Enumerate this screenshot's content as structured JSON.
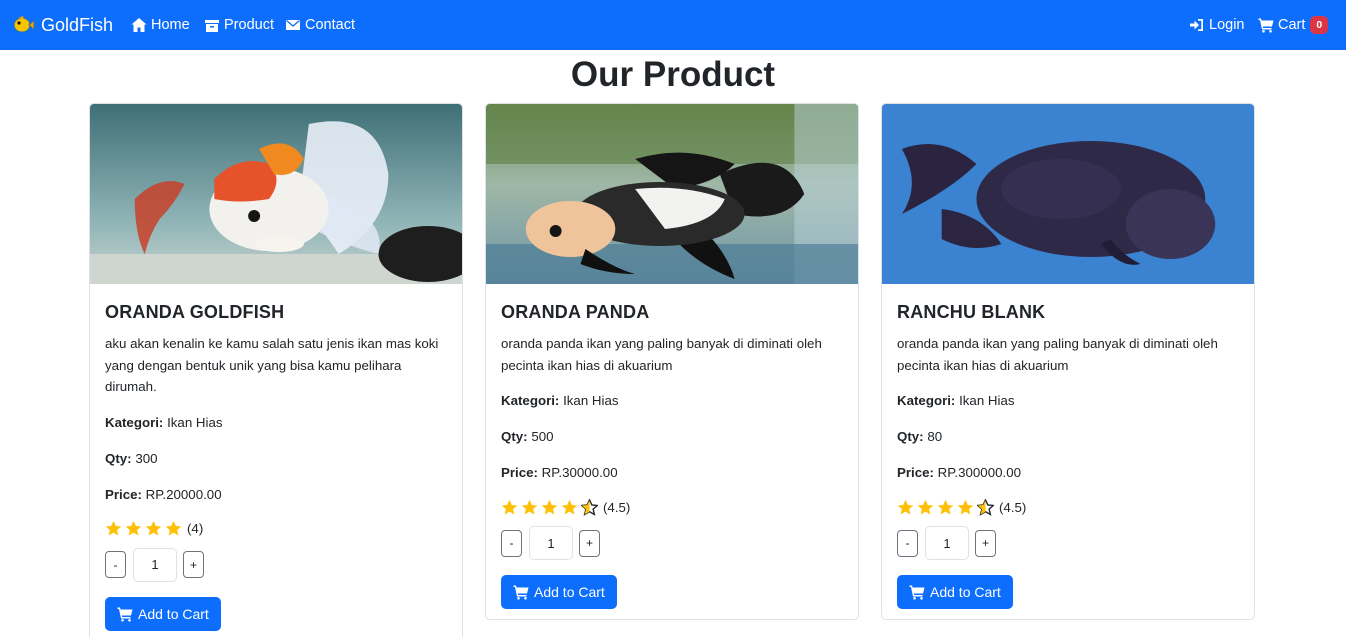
{
  "navbar": {
    "brand": "GoldFish",
    "links": {
      "home": "Home",
      "product": "Product",
      "contact": "Contact",
      "login": "Login",
      "cart": "Cart"
    },
    "cart_count": "0",
    "colors": {
      "background": "#0d6efd",
      "badge": "#dc3545"
    }
  },
  "page": {
    "title": "Our Product"
  },
  "products": [
    {
      "name": "ORANDA GOLDFISH",
      "description": "aku akan kenalin ke kamu salah satu jenis ikan mas koki yang dengan bentuk unik yang bisa kamu pelihara dirumah.",
      "kategori_label": "Kategori:",
      "kategori": "Ikan Hias",
      "qty_label": "Qty:",
      "qty": "300",
      "price_label": "Price:",
      "price": "RP.20000.00",
      "rating": 4,
      "rating_text": "(4)",
      "quantity_value": "1",
      "minus": "-",
      "plus": "+",
      "add_to_cart": "Add to Cart"
    },
    {
      "name": "ORANDA PANDA",
      "description": "oranda panda ikan yang paling banyak di diminati oleh pecinta ikan hias di akuarium",
      "kategori_label": "Kategori:",
      "kategori": "Ikan Hias",
      "qty_label": "Qty:",
      "qty": "500",
      "price_label": "Price:",
      "price": "RP.30000.00",
      "rating": 4.5,
      "rating_text": "(4.5)",
      "quantity_value": "1",
      "minus": "-",
      "plus": "+",
      "add_to_cart": "Add to Cart"
    },
    {
      "name": "RANCHU BLANK",
      "description": "oranda panda ikan yang paling banyak di diminati oleh pecinta ikan hias di akuarium",
      "kategori_label": "Kategori:",
      "kategori": "Ikan Hias",
      "qty_label": "Qty:",
      "qty": "80",
      "price_label": "Price:",
      "price": "RP.300000.00",
      "rating": 4.5,
      "rating_text": "(4.5)",
      "quantity_value": "1",
      "minus": "-",
      "plus": "+",
      "add_to_cart": "Add to Cart"
    }
  ],
  "colors": {
    "star": "#ffc107",
    "primary": "#0d6efd"
  }
}
